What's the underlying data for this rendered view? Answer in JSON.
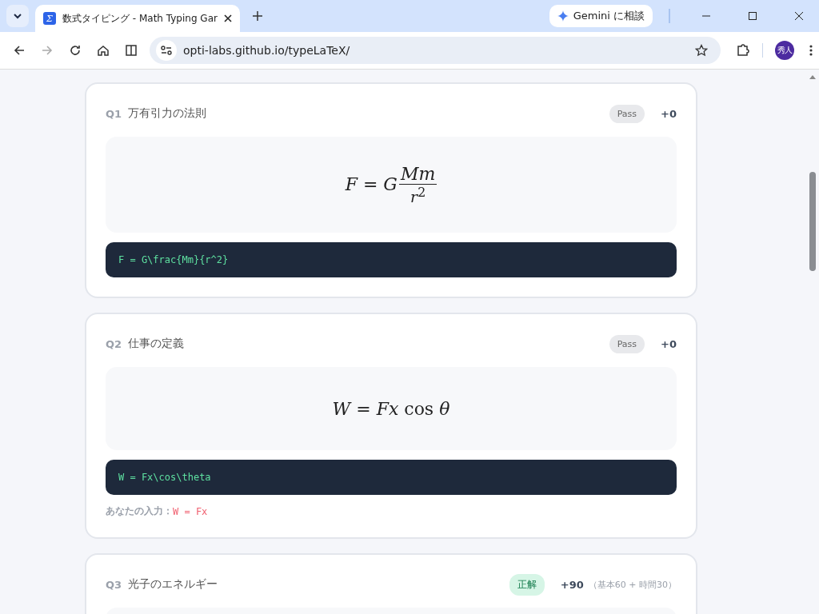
{
  "browser": {
    "tab": {
      "title": "数式タイピング - Math Typing Gar",
      "favicon": "Σ"
    },
    "gemini_button": "Gemini に相談",
    "address": "opti-labs.github.io/typeLaTeX/",
    "profile": "秀人"
  },
  "questions": [
    {
      "number": "Q1",
      "title": "万有引力の法則",
      "status": {
        "kind": "pass",
        "label": "Pass"
      },
      "score": "+0",
      "formula": [
        {
          "kind": "text",
          "text": "*F* = *G*"
        },
        {
          "kind": "frac",
          "num": "*Mm*",
          "den": "*r*$^{2}$"
        }
      ],
      "code": "F = G\\frac{Mm}{r^2}"
    },
    {
      "number": "Q2",
      "title": "仕事の定義",
      "status": {
        "kind": "pass",
        "label": "Pass"
      },
      "score": "+0",
      "formula": [
        {
          "kind": "text",
          "text": "*W* = *Fx* cos *θ*"
        }
      ],
      "code": "W = Fx\\cos\\theta",
      "answer_label": "あなたの入力：",
      "answer": "W = Fx"
    },
    {
      "number": "Q3",
      "title": "光子のエネルギー",
      "status": {
        "kind": "correct",
        "label": "正解"
      },
      "score": "+90",
      "score_detail": "（基本60 + 時間30）"
    }
  ]
}
